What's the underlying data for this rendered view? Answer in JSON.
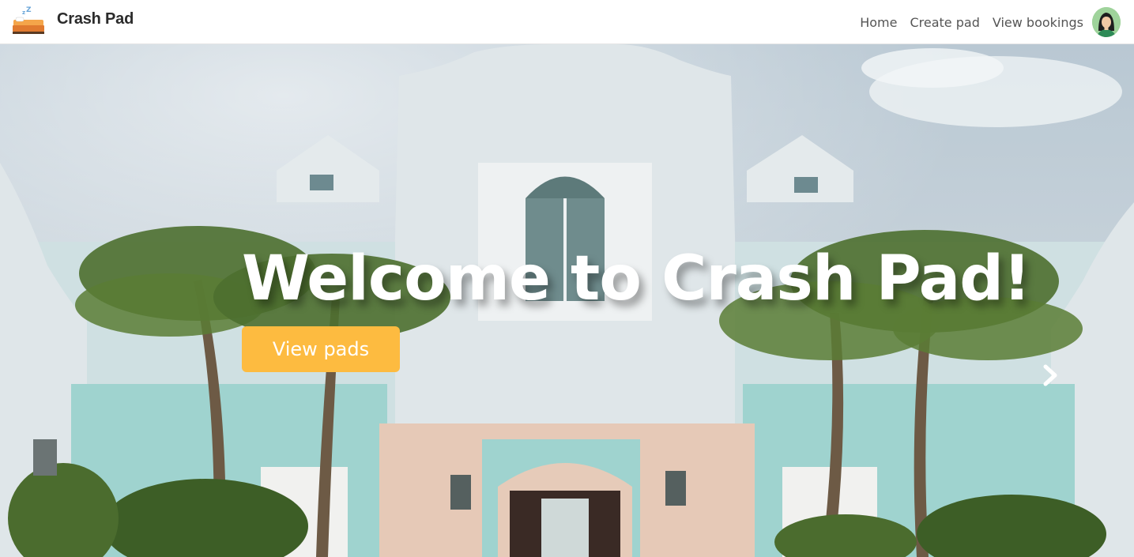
{
  "brand": {
    "name": "Crash Pad",
    "logo_icon": "bed-sleeping-icon"
  },
  "nav": {
    "links": [
      {
        "label": "Home"
      },
      {
        "label": "Create pad"
      },
      {
        "label": "View bookings"
      }
    ],
    "avatar_icon": "user-avatar-icon"
  },
  "hero": {
    "title": "Welcome to Crash Pad!",
    "cta_label": "View pads",
    "next_icon": "chevron-right-icon"
  },
  "colors": {
    "accent": "#fdbb40",
    "nav_text": "#555555",
    "brand_text": "#2b2b2b"
  }
}
